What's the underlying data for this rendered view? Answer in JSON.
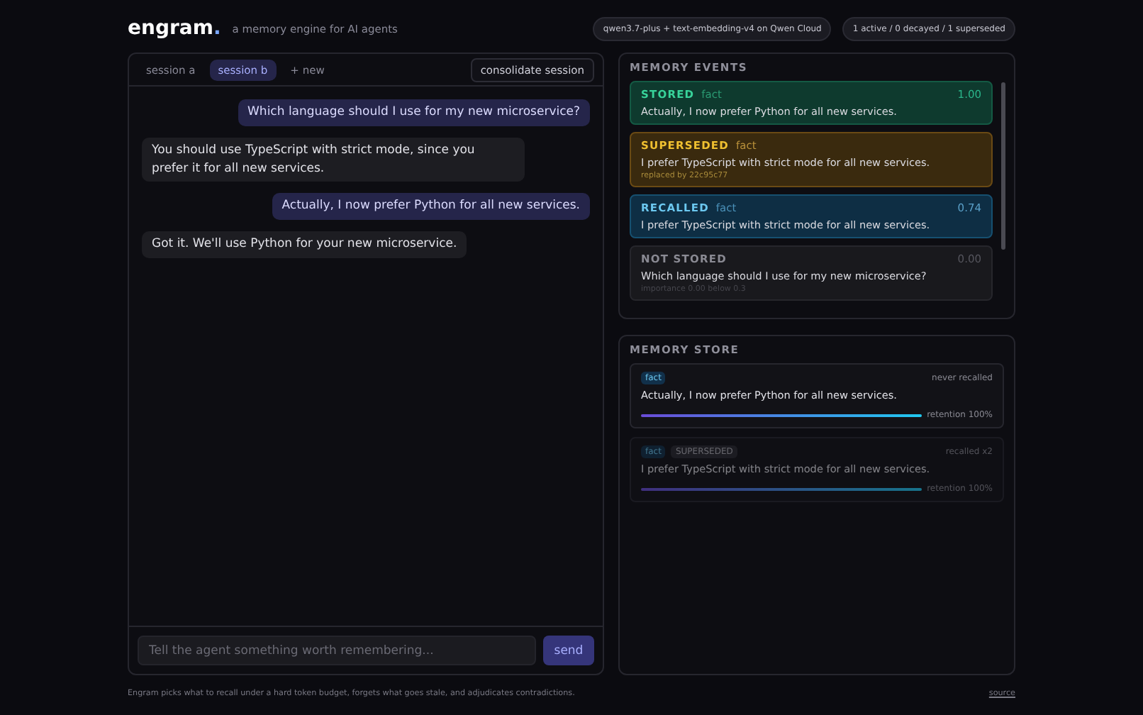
{
  "brand": {
    "name": "engram",
    "dot": ".",
    "tagline": "a memory engine for AI agents"
  },
  "header_pills": [
    "qwen3.7-plus + text-embedding-v4 on Qwen Cloud",
    "1 active / 0 decayed / 1 superseded"
  ],
  "session_tabs": [
    {
      "label": "session a",
      "selected": false
    },
    {
      "label": "session b",
      "selected": true
    },
    {
      "label": "+ new",
      "selected": false
    }
  ],
  "consolidate_button": "consolidate session",
  "messages": [
    {
      "kind": "user",
      "text": "Which language should I use for my new microservice?"
    },
    {
      "kind": "agent",
      "text": "You should use TypeScript with strict mode, since you prefer it for all new services."
    },
    {
      "kind": "user",
      "text": "Actually, I now prefer Python for all new services."
    },
    {
      "kind": "agent",
      "text": "Got it. We'll use Python for your new microservice."
    }
  ],
  "composer": {
    "placeholder": "Tell the agent something worth remembering...",
    "send": "send"
  },
  "memory_events": {
    "title": "MEMORY EVENTS",
    "items": [
      {
        "kind": "stored",
        "label": "STORED",
        "type": "fact",
        "score": "1.00",
        "text": "Actually, I now prefer Python for all new services."
      },
      {
        "kind": "superseded",
        "label": "SUPERSEDED",
        "type": "fact",
        "text": "I prefer TypeScript with strict mode for all new services.",
        "note": "replaced by 22c95c77"
      },
      {
        "kind": "recalled",
        "label": "RECALLED",
        "type": "fact",
        "score": "0.74",
        "text": "I prefer TypeScript with strict mode for all new services."
      },
      {
        "kind": "not_stored",
        "label": "NOT STORED",
        "score": "0.00",
        "text": "Which language should I use for my new microservice?",
        "note": "importance 0.00 below 0.3"
      }
    ]
  },
  "memory_store": {
    "title": "MEMORY STORE",
    "items": [
      {
        "tag": "fact",
        "superseded": false,
        "recall": "never recalled",
        "text": "Actually, I now prefer Python for all new services.",
        "level": 1,
        "retention": "retention 100%"
      },
      {
        "tag": "fact",
        "superseded": true,
        "badge": "SUPERSEDED",
        "recall": "recalled x2",
        "text": "I prefer TypeScript with strict mode for all new services.",
        "level": 1,
        "retention": "retention 100%"
      }
    ]
  },
  "footer": {
    "text": "Engram picks what to recall under a hard token budget, forgets what goes stale, and adjudicates contradictions.",
    "link": "source"
  }
}
